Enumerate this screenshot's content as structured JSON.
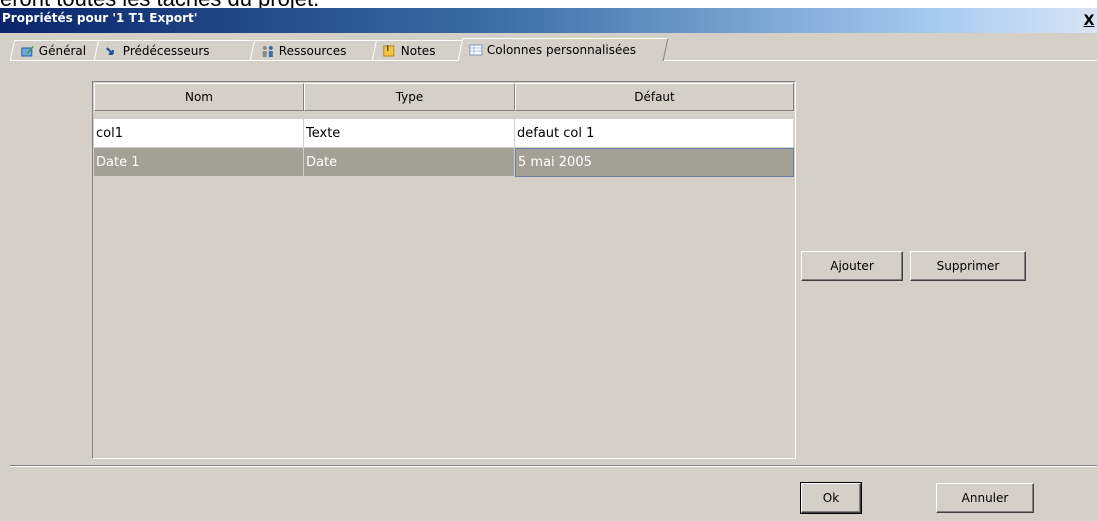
{
  "background_text": "éront toutes les tâches du projet.",
  "dialog": {
    "title": "Propriétés pour '1 T1 Export'",
    "close_label": "X"
  },
  "tabs": [
    {
      "label": "Général",
      "icon": "edit-icon"
    },
    {
      "label": "Prédécesseurs",
      "icon": "arrow-icon"
    },
    {
      "label": "Ressources",
      "icon": "people-icon"
    },
    {
      "label": "Notes",
      "icon": "notes-icon"
    },
    {
      "label": "Colonnes personnalisées",
      "icon": "columns-icon",
      "active": true
    }
  ],
  "table": {
    "headers": [
      "Nom",
      "Type",
      "Défaut"
    ],
    "rows": [
      [
        "col1",
        "Texte",
        "defaut col 1"
      ],
      [
        "Date 1",
        "Date",
        "5 mai 2005"
      ]
    ],
    "selected_row": 1
  },
  "buttons": {
    "add_label": "Ajouter",
    "delete_label": "Supprimer",
    "ok_label": "Ok",
    "cancel_label": "Annuler"
  },
  "colors": {
    "title_start": "#0a246a",
    "dialog_bg": "#d4d0c8",
    "selection_bg": "#a3a195"
  }
}
